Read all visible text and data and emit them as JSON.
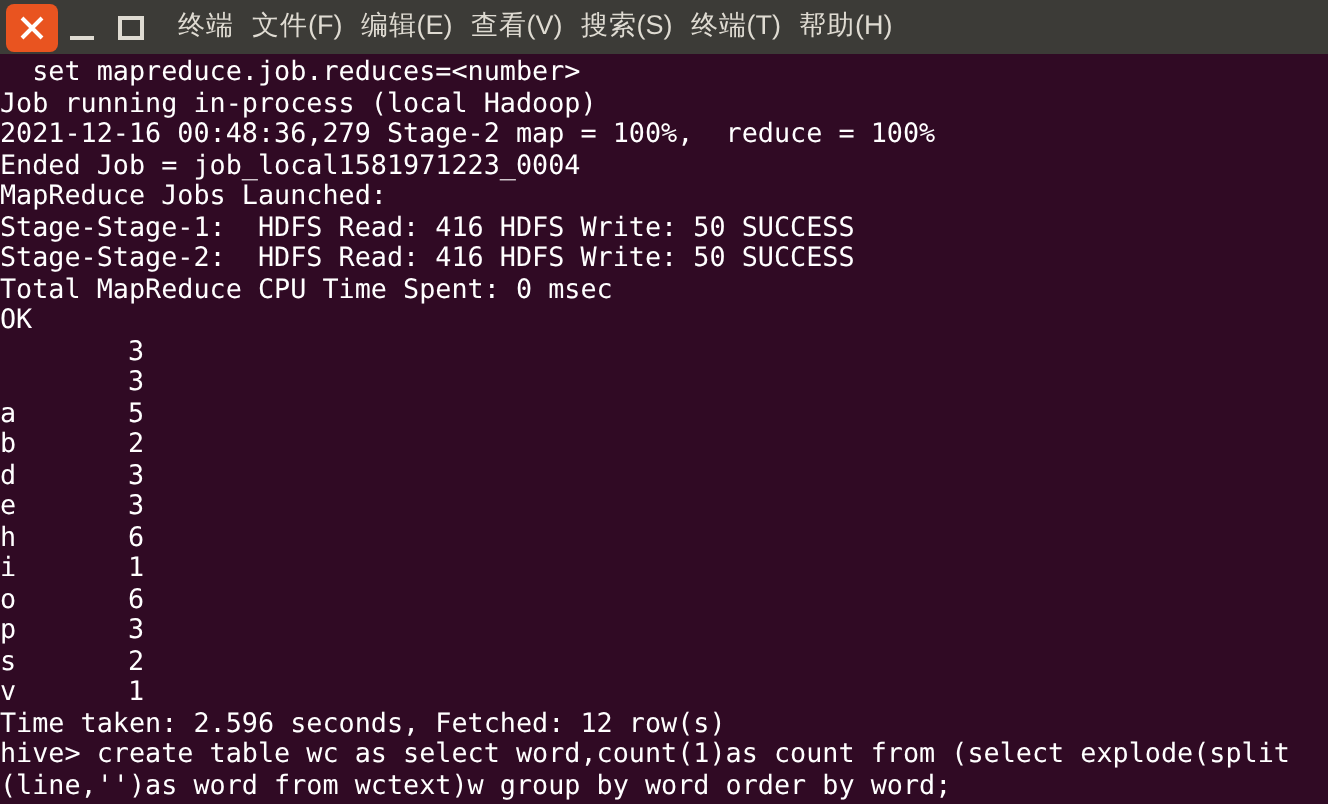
{
  "window": {
    "menu": [
      "终端",
      "文件(F)",
      "编辑(E)",
      "查看(V)",
      "搜索(S)",
      "终端(T)",
      "帮助(H)"
    ]
  },
  "terminal": {
    "lines_before": [
      "  set mapreduce.job.reduces=<number>",
      "Job running in-process (local Hadoop)",
      "2021-12-16 00:48:36,279 Stage-2 map = 100%,  reduce = 100%",
      "Ended Job = job_local1581971223_0004",
      "MapReduce Jobs Launched:",
      "Stage-Stage-1:  HDFS Read: 416 HDFS Write: 50 SUCCESS",
      "Stage-Stage-2:  HDFS Read: 416 HDFS Write: 50 SUCCESS",
      "Total MapReduce CPU Time Spent: 0 msec",
      "OK"
    ],
    "rows": [
      {
        "count": "3"
      },
      {
        "count": "3"
      },
      {
        "word": "a",
        "count": "5"
      },
      {
        "word": "b",
        "count": "2"
      },
      {
        "word": "d",
        "count": "3"
      },
      {
        "word": "e",
        "count": "3"
      },
      {
        "word": "h",
        "count": "6"
      },
      {
        "word": "i",
        "count": "1"
      },
      {
        "word": "o",
        "count": "6"
      },
      {
        "word": "p",
        "count": "3"
      },
      {
        "word": "s",
        "count": "2"
      },
      {
        "word": "v",
        "count": "1"
      }
    ],
    "lines_after": [
      "Time taken: 2.596 seconds, Fetched: 12 row(s)",
      "hive> create table wc as select word,count(1)as count from (select explode(split",
      "(line,'')as word from wctext)w group by word order by word;"
    ]
  }
}
